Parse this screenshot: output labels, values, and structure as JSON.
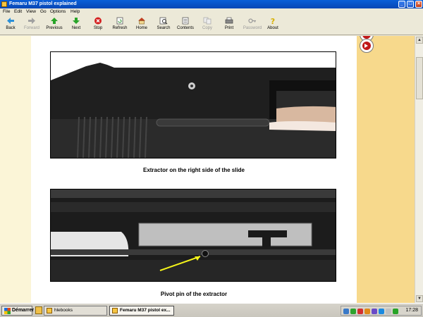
{
  "window": {
    "title": "Femaru M37 pistol explained"
  },
  "menu": [
    "File",
    "Edit",
    "View",
    "Go",
    "Options",
    "Help"
  ],
  "toolbar": [
    {
      "label": "Back",
      "icon": "back-arrow-icon",
      "enabled": true
    },
    {
      "label": "Forward",
      "icon": "forward-arrow-icon",
      "enabled": false
    },
    {
      "label": "Previous",
      "icon": "previous-arrow-icon",
      "enabled": true
    },
    {
      "label": "Next",
      "icon": "next-arrow-icon",
      "enabled": true
    },
    {
      "label": "Stop",
      "icon": "stop-icon",
      "enabled": true
    },
    {
      "label": "Refresh",
      "icon": "refresh-icon",
      "enabled": true
    },
    {
      "label": "Home",
      "icon": "home-icon",
      "enabled": true
    },
    {
      "label": "Search",
      "icon": "search-icon",
      "enabled": true
    },
    {
      "label": "Contents",
      "icon": "contents-icon",
      "enabled": true
    },
    {
      "label": "Copy",
      "icon": "copy-icon",
      "enabled": false
    },
    {
      "label": "Print",
      "icon": "print-icon",
      "enabled": true
    },
    {
      "label": "Password",
      "icon": "key-icon",
      "enabled": false
    },
    {
      "label": "About",
      "icon": "about-icon",
      "enabled": true
    }
  ],
  "document": {
    "figures": [
      {
        "caption": "Extractor on the right side of the slide"
      },
      {
        "caption": "Pivot pin of the extractor"
      }
    ]
  },
  "taskbar": {
    "start_label": "Démarrer",
    "tasks": [
      {
        "label": "hlebooks",
        "active": false
      },
      {
        "label": "Femaru M37 pistol ex...",
        "active": true
      }
    ],
    "clock": "17:28"
  },
  "colors": {
    "titlebar": "#0a5fd8",
    "page_background": "#ffffff",
    "side_panel": "#f7d98c",
    "nav_button": "#c01818"
  }
}
